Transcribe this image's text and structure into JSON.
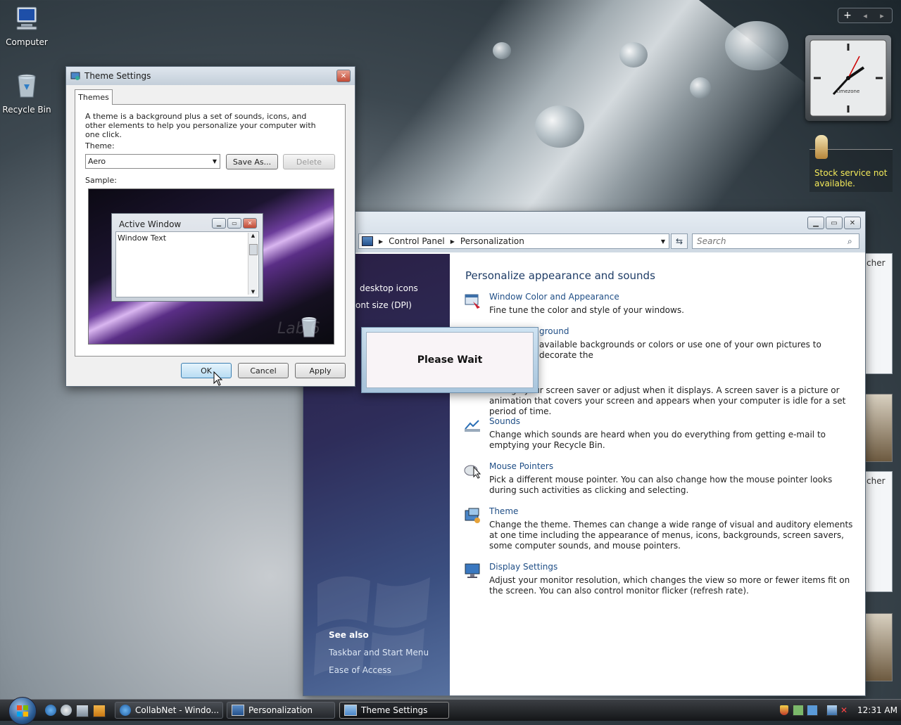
{
  "desktop": {
    "icons": [
      {
        "label": "Computer"
      },
      {
        "label": "Recycle Bin"
      }
    ]
  },
  "sidebar_gadgets": {
    "stock_message": "Stock service not available.",
    "clock_brand": "timezone",
    "feed_label_1": "cher",
    "feed_label_2": "cher"
  },
  "theme_settings": {
    "title": "Theme Settings",
    "tab": "Themes",
    "description": "A theme is a background plus a set of sounds, icons, and other elements to help you personalize your computer with one click.",
    "theme_label": "Theme:",
    "theme_value": "Aero",
    "save_as": "Save As...",
    "delete": "Delete",
    "sample_label": "Sample:",
    "sample_window_title": "Active Window",
    "sample_window_text": "Window Text",
    "sample_watermark": "Lab 6",
    "ok": "OK",
    "cancel": "Cancel",
    "apply": "Apply"
  },
  "please_wait": {
    "text": "Please Wait"
  },
  "personalization": {
    "breadcrumb": [
      "Control Panel",
      "Personalization"
    ],
    "search_placeholder": "Search",
    "heading": "Personalize appearance and sounds",
    "left_tasks": [
      "desktop icons",
      "ont size (DPI)"
    ],
    "see_also_title": "See also",
    "see_also": [
      "Taskbar and Start Menu",
      "Ease of Access"
    ],
    "items": [
      {
        "title": "Window Color and Appearance",
        "desc": "Fine tune the color and style of your windows."
      },
      {
        "title": "ground",
        "desc": "available backgrounds or colors or use one of your own pictures to decorate the"
      },
      {
        "title": "",
        "desc": "Change your screen saver or adjust when it displays. A screen saver is a picture or animation that covers your screen and appears when your computer is idle for a set period of time."
      },
      {
        "title": "Sounds",
        "desc": "Change which sounds are heard when you do everything from getting e-mail to emptying your Recycle Bin."
      },
      {
        "title": "Mouse Pointers",
        "desc": "Pick a different mouse pointer. You can also change how the mouse pointer looks during such activities as clicking and selecting."
      },
      {
        "title": "Theme",
        "desc": "Change the theme. Themes can change a wide range of visual and auditory elements at one time including the appearance of menus, icons, backgrounds, screen savers, some computer sounds, and mouse pointers."
      },
      {
        "title": "Display Settings",
        "desc": "Adjust your monitor resolution, which changes the view so more or fewer items fit on the screen. You can also control monitor flicker (refresh rate)."
      }
    ]
  },
  "taskbar": {
    "buttons": [
      {
        "label": "CollabNet - Windo..."
      },
      {
        "label": "Personalization"
      },
      {
        "label": "Theme Settings"
      }
    ],
    "clock": "12:31 AM"
  }
}
